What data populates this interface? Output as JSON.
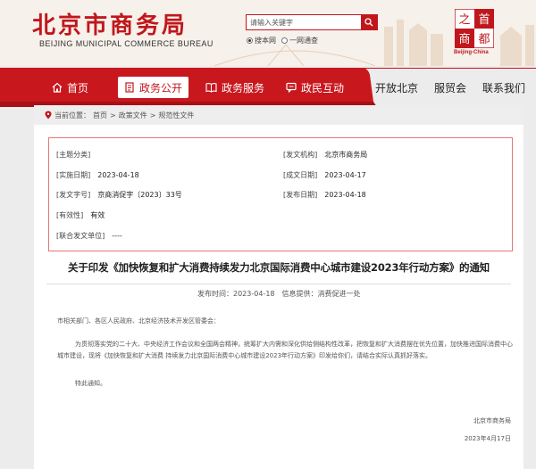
{
  "header": {
    "title_cn": "北京市商务局",
    "title_en": "BEIJING MUNICIPAL COMMERCE BUREAU",
    "search_placeholder": "请输入关键字",
    "search_options": [
      "搜本网",
      "一网通查"
    ],
    "badge_chars": [
      "之",
      "首",
      "商",
      "都"
    ],
    "badge_en": "Beijing-China"
  },
  "nav": {
    "items": [
      "首页",
      "政务公开",
      "政务服务",
      "政民互动"
    ],
    "right_items": [
      "开放北京",
      "服贸会",
      "联系我们"
    ],
    "active_index": 1
  },
  "breadcrumb": {
    "prefix": "当前位置：",
    "items": [
      "首页",
      "政策文件",
      "规范性文件"
    ],
    "separator": ">"
  },
  "meta": {
    "topic_label": "[主题分类]",
    "topic_value": "",
    "issuer_label": "[发文机构]",
    "issuer_value": "北京市商务局",
    "impl_date_label": "[实施日期]",
    "impl_date_value": "2023-04-18",
    "written_date_label": "[成文日期]",
    "written_date_value": "2023-04-17",
    "doc_no_label": "[发文字号]",
    "doc_no_value": "京商消促字〔2023〕33号",
    "publish_date_label": "[发布日期]",
    "publish_date_value": "2023-04-18",
    "validity_label": "[有效性]",
    "validity_value": "有效",
    "joint_label": "[联合发文单位]",
    "joint_value": "----"
  },
  "document": {
    "title": "关于印发《加快恢复和扩大消费持续发力北京国际消费中心城市建设2023年行动方案》的通知",
    "publish_time_label": "发布时间：",
    "publish_time_value": "2023-04-18",
    "source_label": "信息提供：",
    "source_value": "消费促进一处",
    "salutation": "市相关部门、各区人民政府、北京经济技术开发区管委会：",
    "body": "为贯彻落实党的二十大、中央经济工作会议和全国两会精神，统筹扩大内需和深化供给侧结构性改革，把恢复和扩大消费摆在优先位置，加快推进国际消费中心城市建设，现将《加快恢复和扩大消费 持续发力北京国际消费中心城市建设2023年行动方案》印发给你们，请结合实际认真抓好落实。",
    "closing": "特此通知。",
    "signature": "北京市商务局",
    "date": "2023年4月17日"
  },
  "colors": {
    "brand_red": "#c0171d",
    "nav_red": "#c9171e",
    "meta_border": "#e57676"
  }
}
